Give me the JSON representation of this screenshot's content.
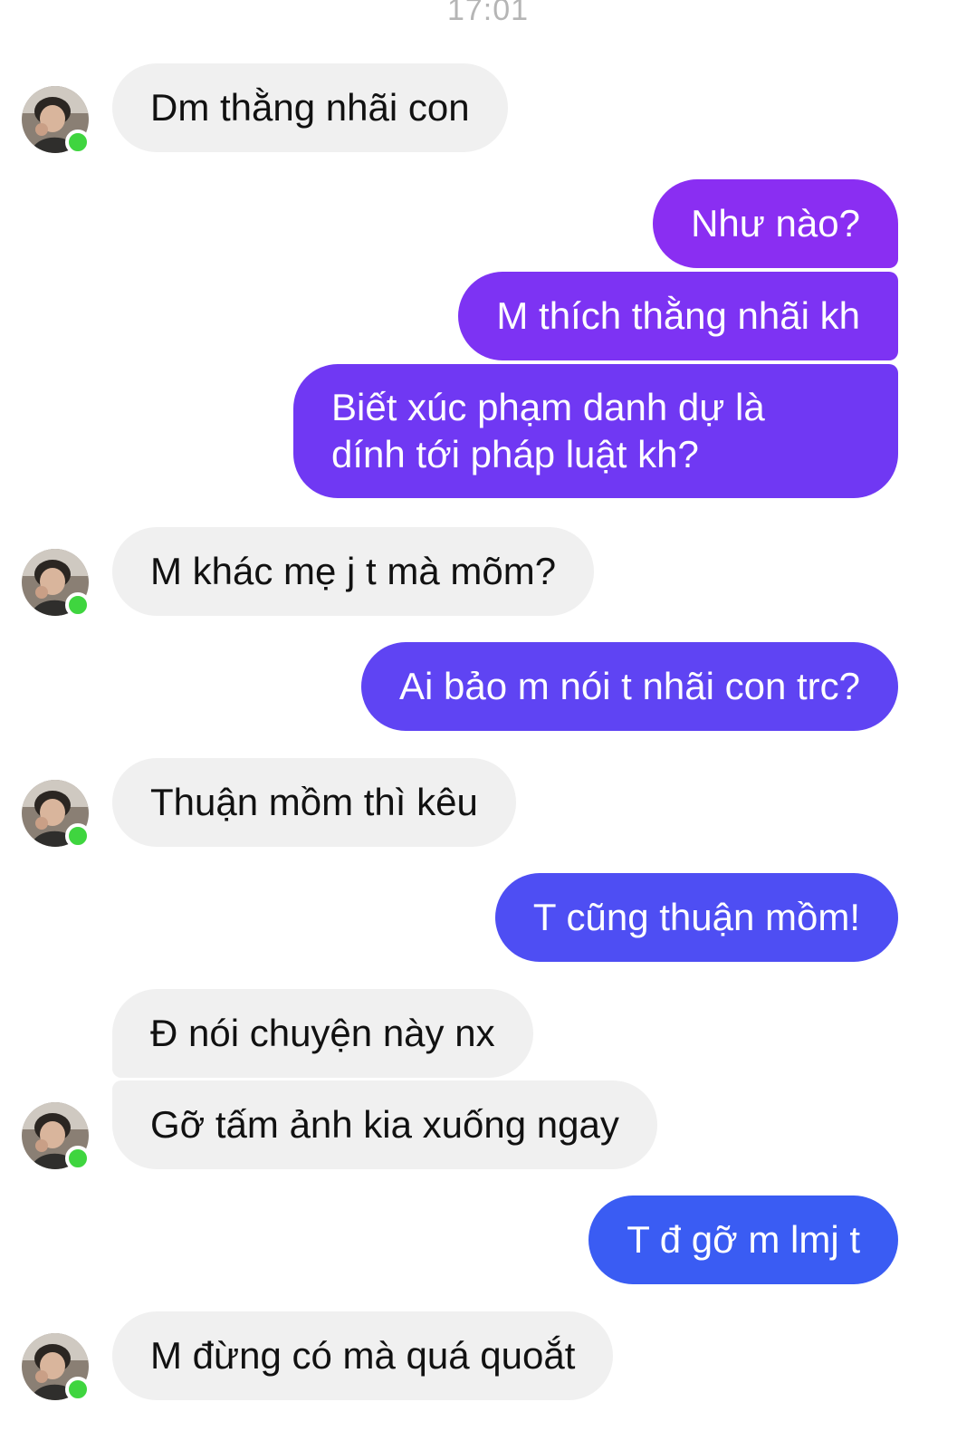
{
  "chat": {
    "timestamp": "17:01",
    "colors": {
      "incoming_bg": "#f0f0f0",
      "online_dot": "#3fd53f",
      "outgoing_gradient": [
        "#8a2ef2",
        "#7a34f3",
        "#6b3bf3",
        "#5b45f3",
        "#4a50f3",
        "#3a5cf3"
      ]
    },
    "messages": [
      {
        "side": "in",
        "text": "Dm thằng nhãi con"
      },
      {
        "side": "out",
        "text": "Như nào?"
      },
      {
        "side": "out",
        "text": "M thích thằng nhãi kh"
      },
      {
        "side": "out",
        "text": "Biết xúc phạm danh dự là"
      },
      {
        "side": "out",
        "text": "dính tới pháp luật kh?"
      },
      {
        "side": "in",
        "text": "M khác mẹ j t mà mõm?"
      },
      {
        "side": "out",
        "text": "Ai bảo m nói t nhãi con trc?"
      },
      {
        "side": "in",
        "text": "Thuận mồm thì kêu"
      },
      {
        "side": "out",
        "text": "T cũng thuận mồm!"
      },
      {
        "side": "in",
        "text": "Đ nói chuyện này nx"
      },
      {
        "side": "in",
        "text": "Gỡ tấm ảnh kia xuống ngay"
      },
      {
        "side": "out",
        "text": "T đ gỡ m lmj t"
      },
      {
        "side": "in",
        "text": "M đừng có mà quá quoắt"
      }
    ]
  }
}
